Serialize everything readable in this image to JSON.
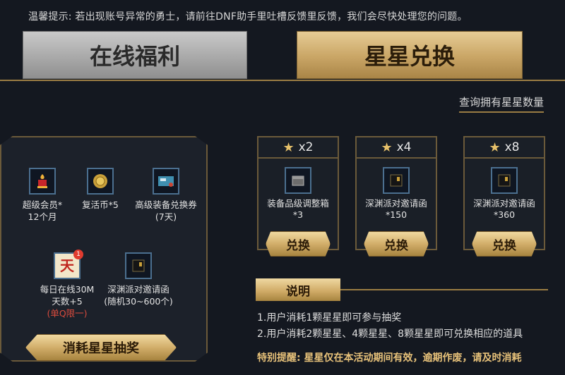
{
  "notice": "温馨提示: 若出现账号异常的勇士，请前往DNF助手里吐槽反馈里反馈，我们会尽快处理您的问题。",
  "tabs": {
    "online": "在线福利",
    "star": "星星兑换"
  },
  "query_link": "查询拥有星星数量",
  "lottery": {
    "prizes": [
      {
        "name": "超级会员*",
        "sub": "12个月",
        "icon": "vip-icon"
      },
      {
        "name": "复活币*5",
        "sub": "",
        "icon": "coin-icon"
      },
      {
        "name": "高级装备兑换券",
        "sub": "(7天)",
        "icon": "ticket-icon"
      },
      {
        "name": "每日在线30M",
        "sub": "天数+5",
        "limit": "(单Q限一)",
        "badge": "1",
        "icon": "day-icon"
      },
      {
        "name": "深渊派对邀请函",
        "sub": "(随机30~600个)",
        "icon": "invitation-icon"
      }
    ],
    "draw_button": "消耗星星抽奖"
  },
  "exchange": {
    "cards": [
      {
        "cost": "x2",
        "name": "装备品级调整箱",
        "qty": "*3",
        "button": "兑换"
      },
      {
        "cost": "x4",
        "name": "深渊派对邀请函",
        "qty": "*150",
        "button": "兑换"
      },
      {
        "cost": "x8",
        "name": "深渊派对邀请函",
        "qty": "*360",
        "button": "兑换"
      }
    ]
  },
  "explain": {
    "title": "说明",
    "lines": [
      "1.用户消耗1颗星星即可参与抽奖",
      "2.用户消耗2颗星星、4颗星星、8颗星星即可兑换相应的道具"
    ],
    "warning": "特别提醒: 星星仅在本活动期间有效，逾期作废，请及时消耗"
  },
  "colors": {
    "gold": "#d2ae6a",
    "line": "#9a7c43",
    "bg": "#141820",
    "limit_red": "#d94b3d"
  }
}
